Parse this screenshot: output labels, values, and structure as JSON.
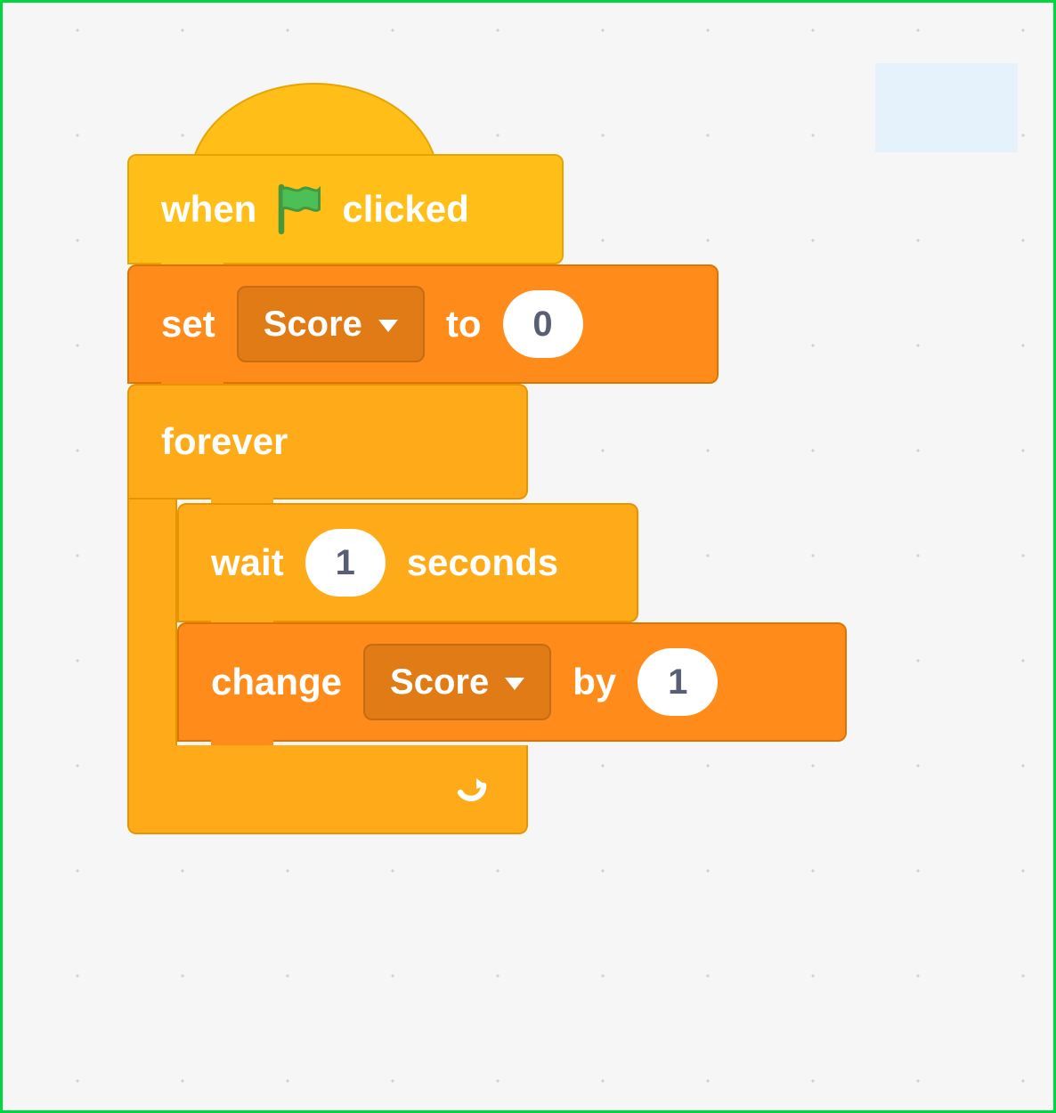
{
  "colors": {
    "events": "#ffbe18",
    "variables": "#ff8c1a",
    "control": "#ffab19",
    "flag": "#4cbf56",
    "canvas_bg": "#f6f6f6",
    "frame_border": "#00d63e"
  },
  "script": {
    "hat": {
      "text_before": "when",
      "text_after": "clicked",
      "icon": "green-flag"
    },
    "blocks": [
      {
        "type": "set_variable",
        "label_set": "set",
        "variable": "Score",
        "label_to": "to",
        "value": "0"
      },
      {
        "type": "forever",
        "label": "forever",
        "children": [
          {
            "type": "wait",
            "label_wait": "wait",
            "seconds": "1",
            "label_seconds": "seconds"
          },
          {
            "type": "change_variable",
            "label_change": "change",
            "variable": "Score",
            "label_by": "by",
            "value": "1"
          }
        ]
      }
    ]
  }
}
